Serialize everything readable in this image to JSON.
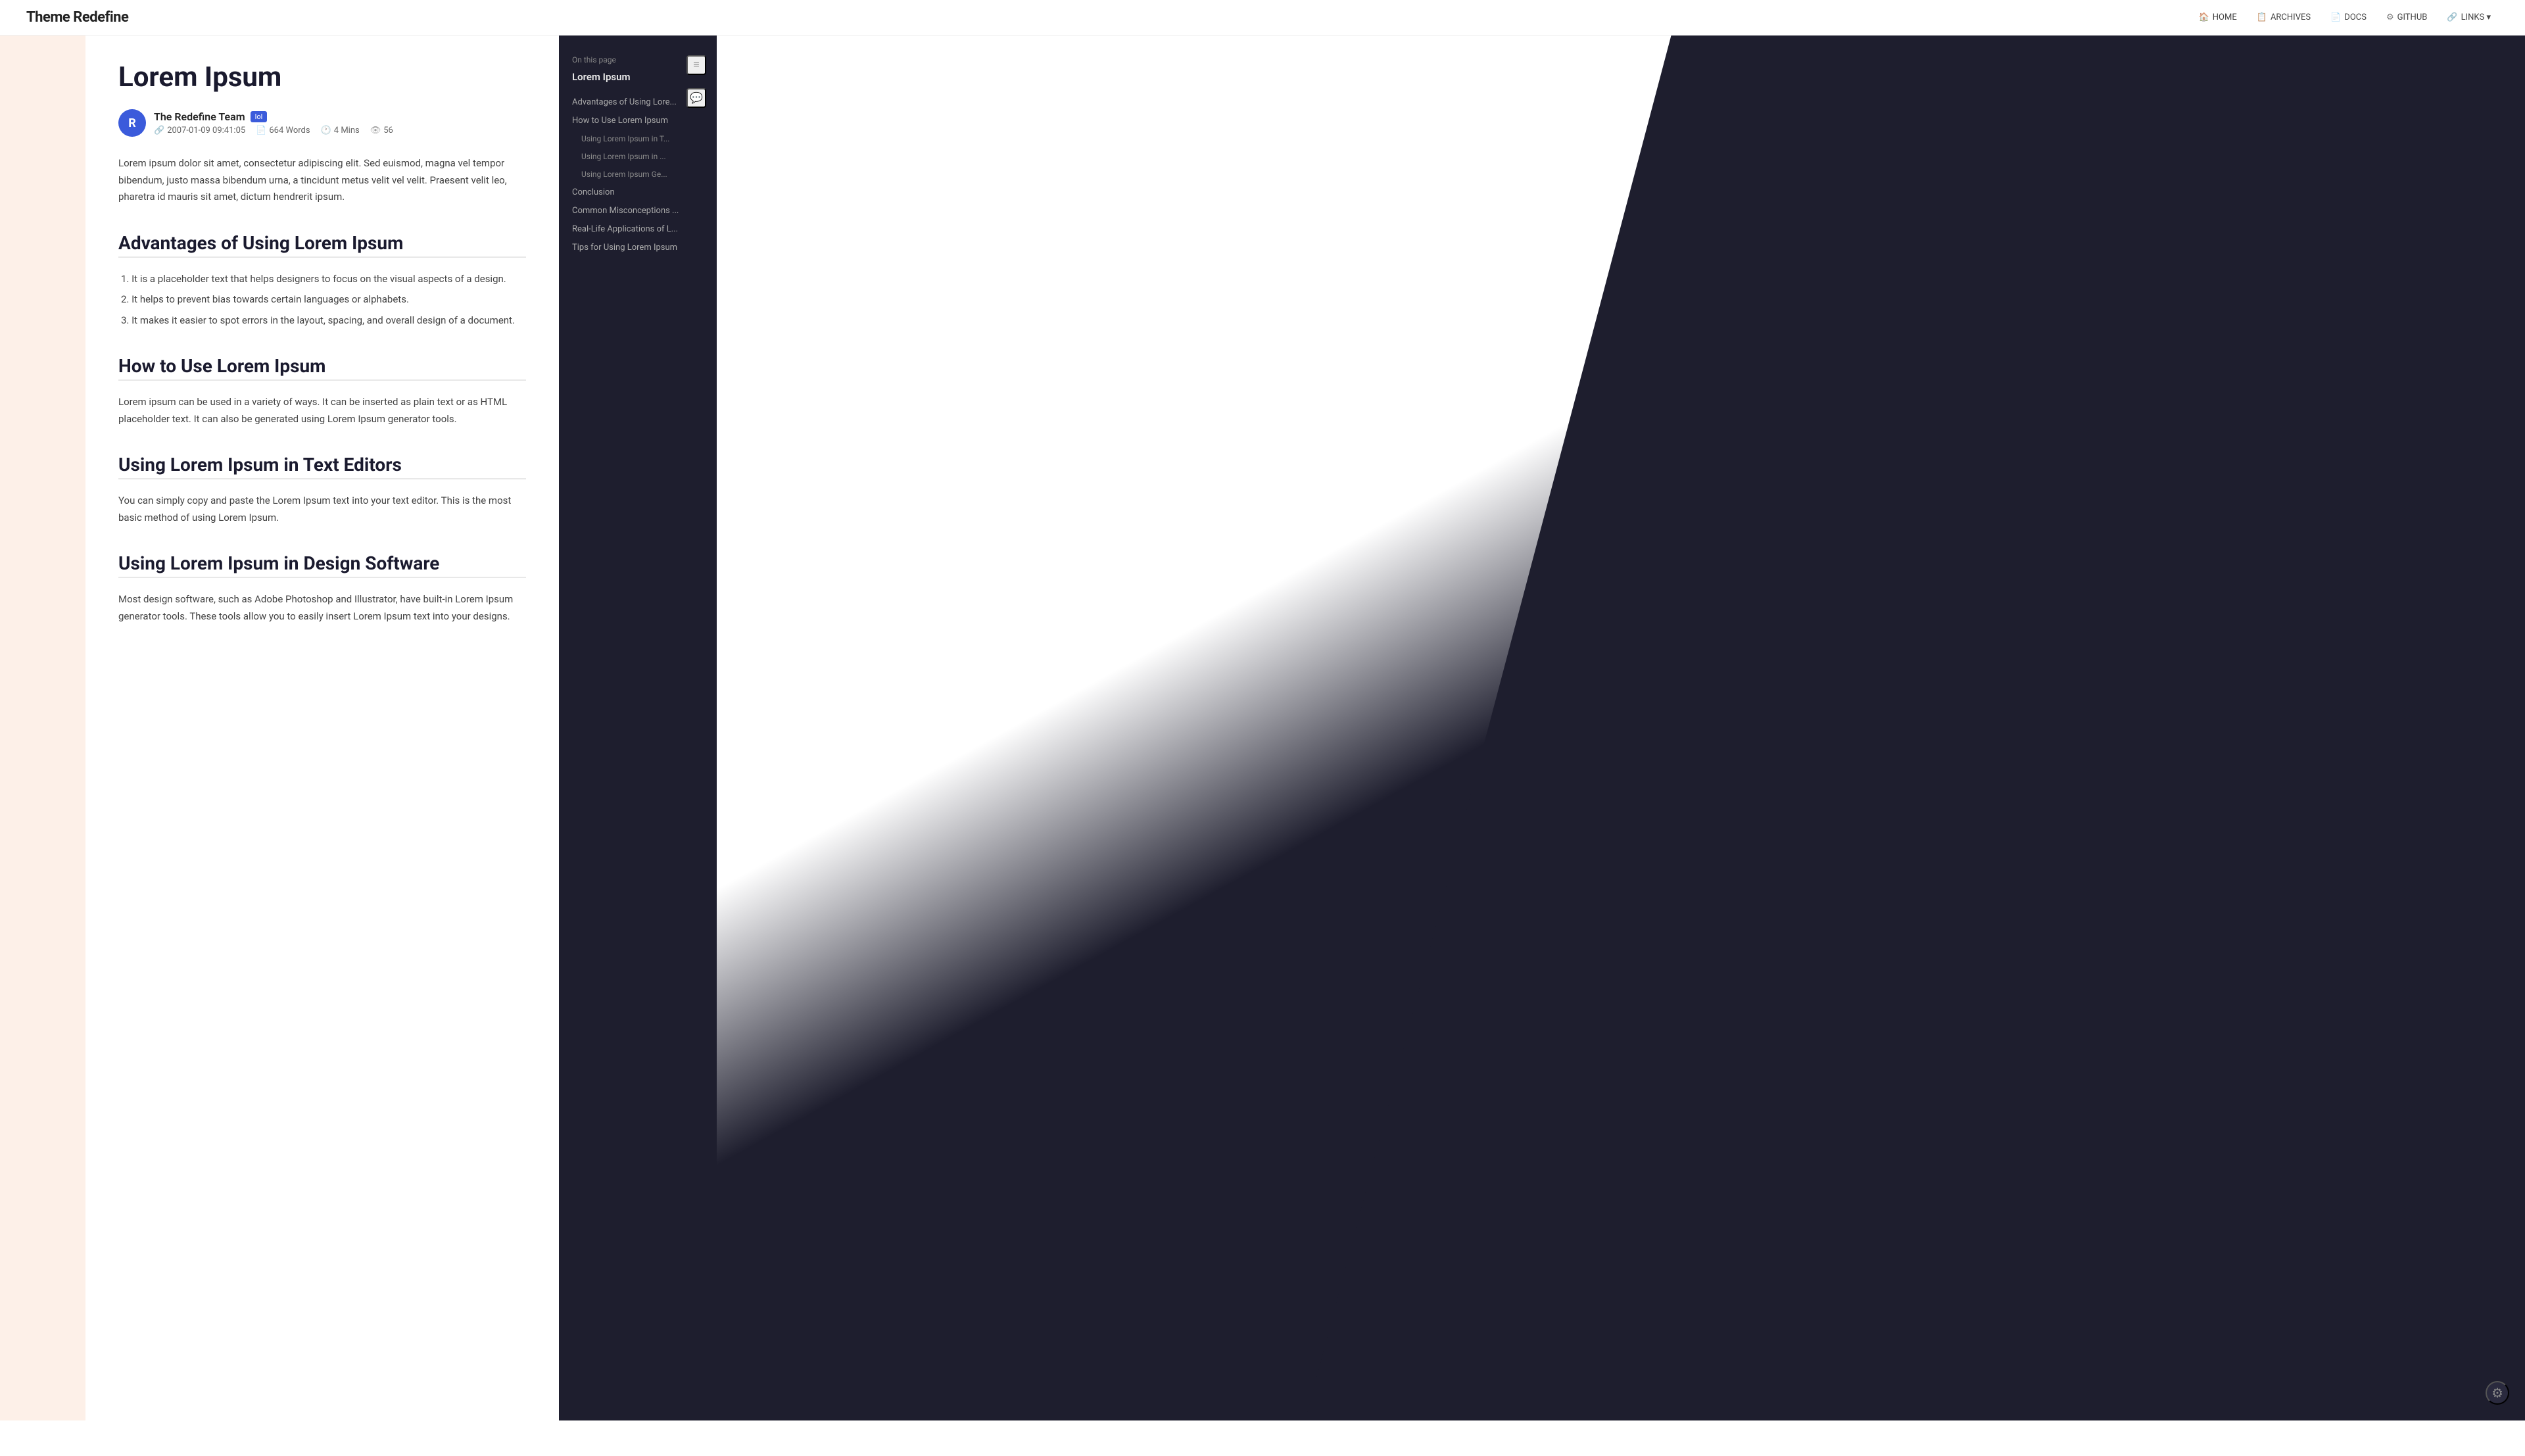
{
  "nav": {
    "brand": "Theme Redefine",
    "links": [
      {
        "id": "home",
        "icon": "🏠",
        "label": "HOME"
      },
      {
        "id": "archives",
        "icon": "📋",
        "label": "ARCHIVES"
      },
      {
        "id": "docs",
        "icon": "📄",
        "label": "DOCS"
      },
      {
        "id": "github",
        "icon": "⚙",
        "label": "GITHUB"
      },
      {
        "id": "links",
        "icon": "🔗",
        "label": "LINKS ▾"
      }
    ]
  },
  "article": {
    "title": "Lorem Ipsum",
    "author": {
      "name": "The Redefine Team",
      "badge": "lol",
      "avatar_letter": "R",
      "date": "2007-01-09 09:41:05",
      "words": "664 Words",
      "read_time": "4 Mins",
      "views": "56"
    },
    "intro": "Lorem ipsum dolor sit amet, consectetur adipiscing elit. Sed euismod, magna vel tempor bibendum, justo massa bibendum urna, a tincidunt metus velit vel velit. Praesent velit leo, pharetra id mauris sit amet, dictum hendrerit ipsum.",
    "sections": [
      {
        "id": "advantages",
        "heading": "Advantages of Using Lorem Ipsum",
        "type": "list",
        "items": [
          "1. It is a placeholder text that helps designers to focus on the visual aspects of a design.",
          "2. It helps to prevent bias towards certain languages or alphabets.",
          "3. It makes it easier to spot errors in the layout, spacing, and overall design of a document."
        ]
      },
      {
        "id": "how-to-use",
        "heading": "How to Use Lorem Ipsum",
        "type": "text",
        "text": "Lorem ipsum can be used in a variety of ways. It can be inserted as plain text or as HTML placeholder text. It can also be generated using Lorem Ipsum generator tools."
      },
      {
        "id": "text-editors",
        "heading": "Using Lorem Ipsum in Text Editors",
        "type": "text",
        "text": "You can simply copy and paste the Lorem Ipsum text into your text editor. This is the most basic method of using Lorem Ipsum."
      },
      {
        "id": "design-software",
        "heading": "Using Lorem Ipsum in Design Software",
        "type": "text",
        "text": "Most design software, such as Adobe Photoshop and Illustrator, have built-in Lorem Ipsum generator tools. These tools allow you to easily insert Lorem Ipsum text into your designs."
      }
    ]
  },
  "toc": {
    "on_this_page": "On this page",
    "title": "Lorem Ipsum",
    "items": [
      {
        "id": "toc-advantages",
        "label": "Advantages of Using Lore...",
        "level": 1
      },
      {
        "id": "toc-how-to-use",
        "label": "How to Use Lorem Ipsum",
        "level": 1
      },
      {
        "id": "toc-text-editors",
        "label": "Using Lorem Ipsum in T...",
        "level": 2
      },
      {
        "id": "toc-design-software",
        "label": "Using Lorem Ipsum in ...",
        "level": 2
      },
      {
        "id": "toc-generators",
        "label": "Using Lorem Ipsum Ge...",
        "level": 2
      },
      {
        "id": "toc-conclusion",
        "label": "Conclusion",
        "level": 1
      },
      {
        "id": "toc-misconceptions",
        "label": "Common Misconceptions ...",
        "level": 1
      },
      {
        "id": "toc-real-life",
        "label": "Real-Life Applications of L...",
        "level": 1
      },
      {
        "id": "toc-tips",
        "label": "Tips for Using Lorem Ipsum",
        "level": 1
      }
    ]
  },
  "sidebar_icons": {
    "list_icon": "≡",
    "comment_icon": "💬"
  },
  "settings_icon": "⚙"
}
